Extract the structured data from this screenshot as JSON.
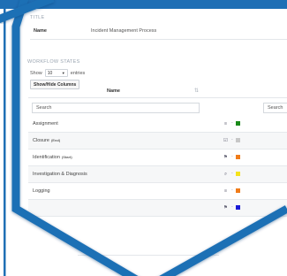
{
  "details": {
    "section_label": "TITLE",
    "name_label": "Name",
    "name_value": "Incident Management Process"
  },
  "workflow": {
    "section_label": "WORKFLOW STATES",
    "show_label": "Show",
    "entries_value": "10",
    "entries_label": "entries",
    "toggle_columns_label": "Show/Hide Columns",
    "column_name": "Name",
    "search_placeholder": "Search",
    "search_right_placeholder": "Search",
    "rows": [
      {
        "name": "Assignment",
        "tag": "",
        "icon": "list-icon",
        "icon_glyph": "≡",
        "color": "#1a8a1a"
      },
      {
        "name": "Closure",
        "tag": "(End)",
        "icon": "checkbox-icon",
        "icon_glyph": "☑",
        "color": "#c7c7c7"
      },
      {
        "name": "Identification",
        "tag": "(Start)",
        "icon": "flag-icon",
        "icon_glyph": "⚑",
        "color": "#f07c1a"
      },
      {
        "name": "Investigation & Diagnosis",
        "tag": "",
        "icon": "search-icon",
        "icon_glyph": "⌕",
        "color": "#f4e21c"
      },
      {
        "name": "Logging",
        "tag": "",
        "icon": "list-icon",
        "icon_glyph": "≡",
        "color": "#f07c1a"
      },
      {
        "name": "",
        "tag": "",
        "icon": "flag-icon",
        "icon_glyph": "⚑",
        "color": "#1a1ad6"
      }
    ]
  },
  "colors": {
    "frame": "#1f6fb5",
    "frame_shadow": "#0e3d73"
  }
}
